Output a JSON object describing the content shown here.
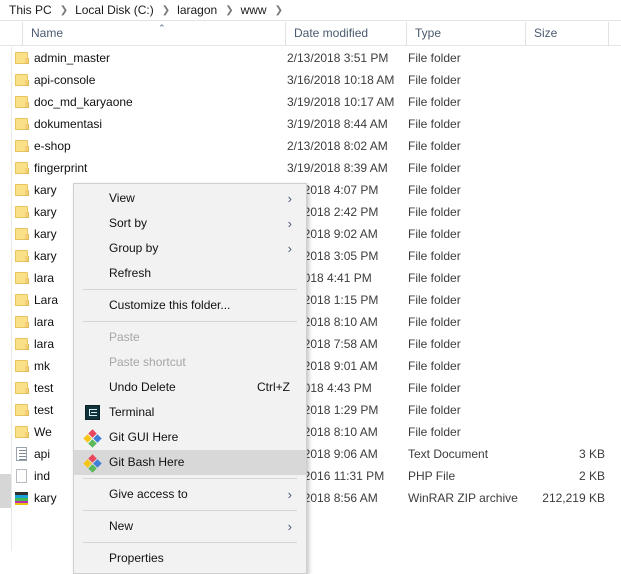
{
  "breadcrumb": {
    "separator": "❯",
    "items": [
      {
        "label": "This PC"
      },
      {
        "label": "Local Disk (C:)"
      },
      {
        "label": "laragon"
      },
      {
        "label": "www"
      }
    ]
  },
  "columns": {
    "name": "Name",
    "date_modified": "Date modified",
    "type": "Type",
    "size": "Size",
    "sort_caret": "⌃"
  },
  "files": [
    {
      "name": "admin_master",
      "icon": "folder-icon",
      "date": "2/13/2018 3:51 PM",
      "type": "File folder",
      "size": ""
    },
    {
      "name": "api-console",
      "icon": "folder-icon",
      "date": "3/16/2018 10:18 AM",
      "type": "File folder",
      "size": ""
    },
    {
      "name": "doc_md_karyaone",
      "icon": "folder-icon",
      "date": "3/19/2018 10:17 AM",
      "type": "File folder",
      "size": ""
    },
    {
      "name": "dokumentasi",
      "icon": "folder-icon",
      "date": "3/19/2018 8:44 AM",
      "type": "File folder",
      "size": ""
    },
    {
      "name": "e-shop",
      "icon": "folder-icon",
      "date": "2/13/2018 8:02 AM",
      "type": "File folder",
      "size": ""
    },
    {
      "name": "fingerprint",
      "icon": "folder-icon",
      "date": "3/19/2018 8:39 AM",
      "type": "File folder",
      "size": ""
    },
    {
      "name": "kary",
      "icon": "folder-icon",
      "date": "15/2018 4:07 PM",
      "type": "File folder",
      "size": ""
    },
    {
      "name": "kary",
      "icon": "folder-icon",
      "date": "13/2018 2:42 PM",
      "type": "File folder",
      "size": ""
    },
    {
      "name": "kary",
      "icon": "folder-icon",
      "date": "14/2018 9:02 AM",
      "type": "File folder",
      "size": ""
    },
    {
      "name": "kary",
      "icon": "folder-icon",
      "date": "14/2018 3:05 PM",
      "type": "File folder",
      "size": ""
    },
    {
      "name": "lara",
      "icon": "folder-icon",
      "date": "5/2018 4:41 PM",
      "type": "File folder",
      "size": ""
    },
    {
      "name": "Lara",
      "icon": "folder-icon",
      "date": "14/2018 1:15 PM",
      "type": "File folder",
      "size": ""
    },
    {
      "name": "lara",
      "icon": "folder-icon",
      "date": "15/2018 8:10 AM",
      "type": "File folder",
      "size": ""
    },
    {
      "name": "lara",
      "icon": "folder-icon",
      "date": "15/2018 7:58 AM",
      "type": "File folder",
      "size": ""
    },
    {
      "name": "mk",
      "icon": "folder-icon",
      "date": "15/2018 9:01 AM",
      "type": "File folder",
      "size": ""
    },
    {
      "name": "test",
      "icon": "folder-icon",
      "date": "8/2018 4:43 PM",
      "type": "File folder",
      "size": ""
    },
    {
      "name": "test",
      "icon": "folder-icon",
      "date": "13/2018 1:29 PM",
      "type": "File folder",
      "size": ""
    },
    {
      "name": "We",
      "icon": "folder-icon",
      "date": "22/2018 8:10 AM",
      "type": "File folder",
      "size": ""
    },
    {
      "name": "api",
      "icon": "text-file-icon",
      "date": "16/2018 9:06 AM",
      "type": "Text Document",
      "size": "3 KB"
    },
    {
      "name": "ind",
      "icon": "php-file-icon",
      "date": "27/2016 11:31 PM",
      "type": "PHP File",
      "size": "2 KB"
    },
    {
      "name": "kary",
      "icon": "zip-file-icon",
      "date": "16/2018 8:56 AM",
      "type": "WinRAR ZIP archive",
      "size": "212,219 KB"
    }
  ],
  "context_menu": {
    "submenu_arrow": "›",
    "items": [
      {
        "label": "View",
        "kind": "submenu",
        "icon": ""
      },
      {
        "label": "Sort by",
        "kind": "submenu",
        "icon": ""
      },
      {
        "label": "Group by",
        "kind": "submenu",
        "icon": ""
      },
      {
        "label": "Refresh",
        "kind": "item",
        "icon": ""
      },
      {
        "label": "",
        "kind": "separator",
        "icon": ""
      },
      {
        "label": "Customize this folder...",
        "kind": "item",
        "icon": ""
      },
      {
        "label": "",
        "kind": "separator",
        "icon": ""
      },
      {
        "label": "Paste",
        "kind": "disabled",
        "icon": ""
      },
      {
        "label": "Paste shortcut",
        "kind": "disabled",
        "icon": ""
      },
      {
        "label": "Undo Delete",
        "kind": "item",
        "icon": "",
        "accel": "Ctrl+Z"
      },
      {
        "label": "Terminal",
        "kind": "item",
        "icon": "terminal-icon"
      },
      {
        "label": "Git GUI Here",
        "kind": "item",
        "icon": "git-icon"
      },
      {
        "label": "Git Bash Here",
        "kind": "selected",
        "icon": "git-icon"
      },
      {
        "label": "",
        "kind": "separator",
        "icon": ""
      },
      {
        "label": "Give access to",
        "kind": "submenu",
        "icon": ""
      },
      {
        "label": "",
        "kind": "separator",
        "icon": ""
      },
      {
        "label": "New",
        "kind": "submenu",
        "icon": ""
      },
      {
        "label": "",
        "kind": "separator",
        "icon": ""
      },
      {
        "label": "Properties",
        "kind": "item",
        "icon": ""
      }
    ]
  },
  "colors": {
    "menu_background": "#f2f2f2",
    "menu_selected": "#d8d8d8",
    "header_text": "#4a5a70",
    "folder_icon": "#fbe08a"
  }
}
